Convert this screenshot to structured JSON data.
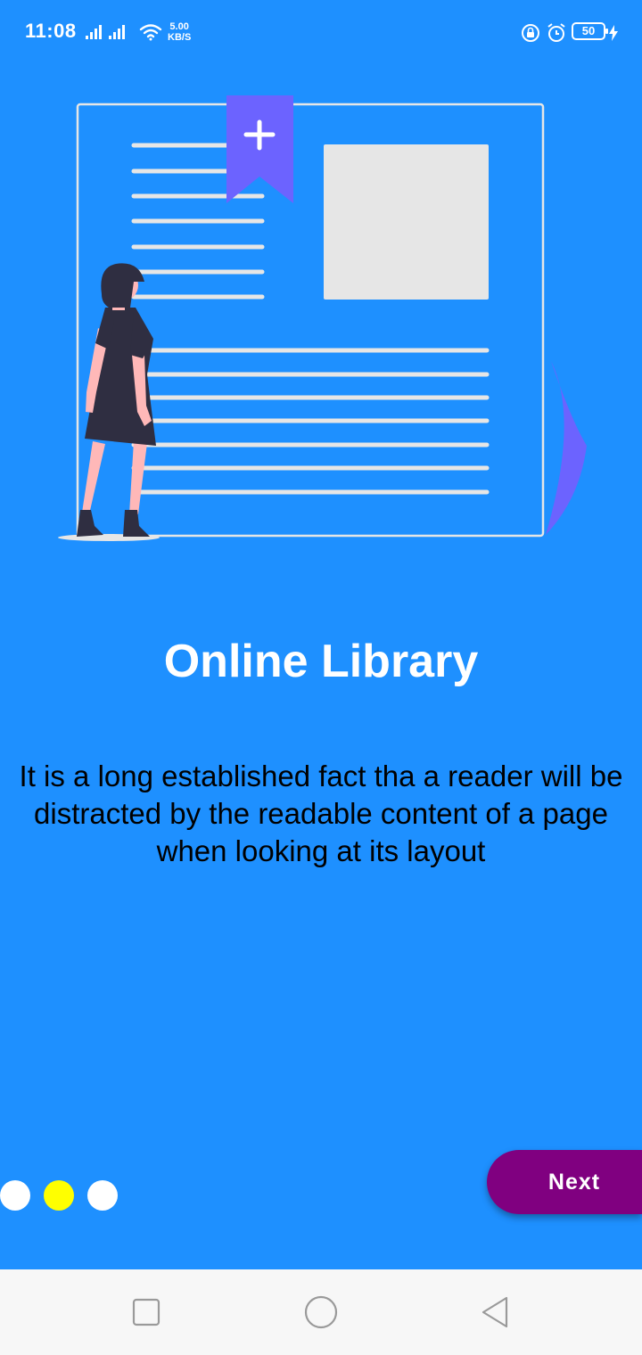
{
  "status_bar": {
    "time": "11:08",
    "net_speed_value": "5.00",
    "net_speed_unit": "KB/S",
    "battery_level": "50",
    "icons_left": [
      "signal-icon",
      "signal-icon",
      "wifi-icon"
    ],
    "icons_right": [
      "lock-rotation-icon",
      "alarm-icon",
      "battery-icon",
      "charging-icon"
    ]
  },
  "onboarding": {
    "title": "Online Library",
    "description": "It is a long established fact tha a reader will be distracted by the readable content of a page when looking at its layout",
    "current_page": 2,
    "total_pages": 3,
    "next_label": "Next"
  },
  "colors": {
    "background": "#1e90ff",
    "dot_active": "#ffff00",
    "dot_inactive": "#ffffff",
    "next_button": "#800080",
    "bookmark": "#6c63ff",
    "image_placeholder": "#e6e6e6"
  },
  "nav_bar": {
    "buttons": [
      "recents-icon",
      "home-icon",
      "back-icon"
    ]
  }
}
